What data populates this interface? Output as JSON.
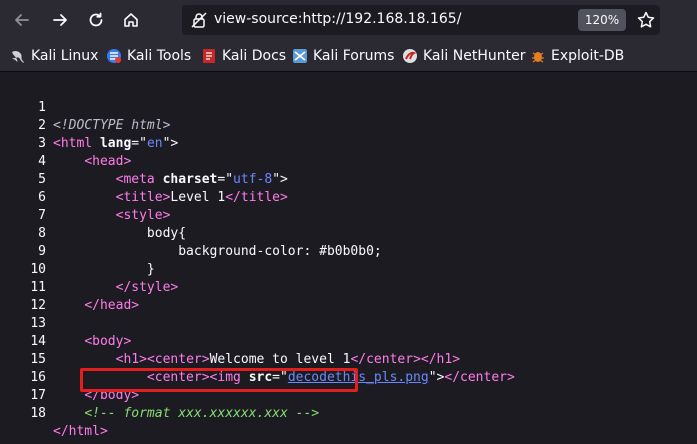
{
  "toolbar": {
    "back_icon": "arrow-left-icon",
    "forward_icon": "arrow-right-icon",
    "reload_icon": "reload-icon",
    "home_icon": "home-icon",
    "url": "view-source:http://192.168.18.165/",
    "zoom": "120%"
  },
  "bookmarks": [
    {
      "label": "Kali Linux"
    },
    {
      "label": "Kali Tools"
    },
    {
      "label": "Kali Docs"
    },
    {
      "label": "Kali Forums"
    },
    {
      "label": "Kali NetHunter"
    },
    {
      "label": "Exploit-DB"
    }
  ],
  "source": {
    "line_numbers": [
      "1",
      "2",
      "3",
      "4",
      "5",
      "6",
      "7",
      "8",
      "9",
      "10",
      "11",
      "12",
      "13",
      "14",
      "15",
      "16",
      "17",
      "18"
    ],
    "l1": "<!DOCTYPE html>",
    "l2_tag_open": "<html",
    "l2_attr": "lang",
    "l2_eq": "=\"",
    "l2_val": "en",
    "l2_end": "\">",
    "l3": "<head>",
    "l4_tag": "<meta",
    "l4_attr": "charset",
    "l4_val": "utf-8",
    "l4_end": "\">",
    "l5_tag_open": "<title>",
    "l5_text": "Level 1",
    "l5_tag_close": "</title>",
    "l6": "<style>",
    "l7": "body{",
    "l8": "background-color: #b0b0b0;",
    "l9": "}",
    "l10": "</style>",
    "l11": "</head>",
    "l13": "<body>",
    "l14_h1": "<h1>",
    "l14_center": "<center>",
    "l14_text": "Welcome to level 1",
    "l14_center_close": "</center>",
    "l14_h1_close": "</h1>",
    "l15_center": "<center>",
    "l15_img": "<img",
    "l15_attr": "src",
    "l15_link": "decodethis_pls.png",
    "l15_end": "\">",
    "l15_center_close": "</center>",
    "l16": "</body>",
    "l17": "<!-- format xxx.xxxxxx.xxx -->",
    "l18": "</html>"
  }
}
